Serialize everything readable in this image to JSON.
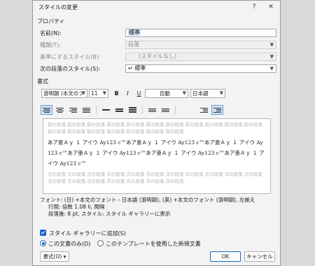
{
  "dialog": {
    "title": "スタイルの変更",
    "help": "?",
    "close": "✕"
  },
  "properties": {
    "heading": "プロパティ",
    "name_label": "名前(N):",
    "name_value": "標準",
    "type_label": "種類(T):",
    "type_value": "段落",
    "base_label": "基準にするスタイル(B):",
    "base_value": "(スタイルなし)",
    "next_label": "次の段落のスタイル(S):",
    "next_value": "標準",
    "next_icon": "↵"
  },
  "format": {
    "heading": "書式",
    "font": "游明朝 (本文のフ",
    "size": "11",
    "bold": "B",
    "italic": "I",
    "underline": "U",
    "color": "自動",
    "language": "日本語"
  },
  "preview": {
    "before": "前の段落 前の段落 前の段落 前の段落 前の段落 前の段落 前の段落 前の段落 前の段落 前の段落 前の段落 前の段落 前の段落 前の段落 前の段落 前の段落 前の段落 前の段落",
    "sample": "あア亜Ａｙ １ アイウ Ay123 c™あア亜Ａｙ １ アイウ Ay123 c™あア亜Ａｙ １ アイウ Ay123 c™あア亜Ａｙ １ アイウ Ay123 c™あア亜Ａｙ １ アイウ Ay123 c™あア亜Ａｙ １ アイウ Ay123 c™",
    "after": "次の段落 次の段落 次の段落 次の段落 次の段落 次の段落 次の段落 次の段落 次の段落 次の段落 次の段落 次の段落 次の段落 次の段落 次の段落 次の段落 次の段落 次の段落"
  },
  "description": {
    "line1": "フォント: (日) +本文のフォント - 日本語 (游明朝), (英) +本文のフォント (游明朝), 左揃え",
    "line2": "行間:  倍数 1.08 li, 間隔",
    "line3": "段落後:  8 pt, スタイル: スタイル ギャラリーに表示"
  },
  "options": {
    "gallery": "スタイル ギャラリーに追加(S)",
    "this_doc": "この文書のみ(D)",
    "template": "このテンプレートを使用した新規文書"
  },
  "buttons": {
    "format": "書式(O) ▾",
    "ok": "OK",
    "cancel": "キャンセル"
  },
  "colors": {
    "accent": "#1a66c7",
    "selection": "#cfe0f7"
  }
}
